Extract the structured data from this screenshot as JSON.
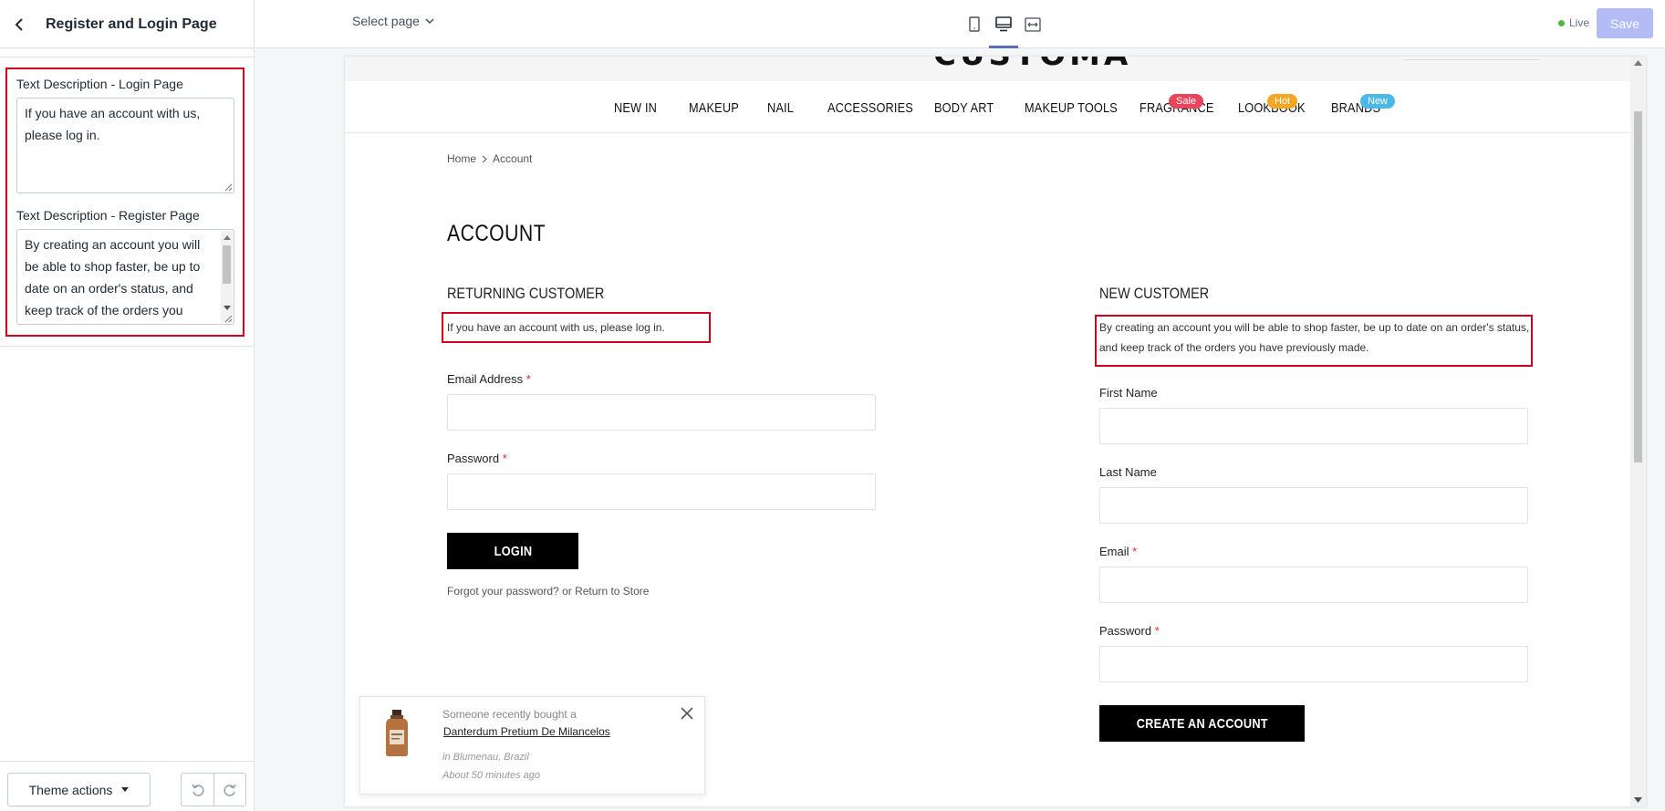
{
  "topbar": {
    "page_title": "Register and Login Page",
    "select_page": "Select page",
    "live_label": "Live",
    "save_label": "Save"
  },
  "sidebar": {
    "login_desc_label": "Text Description - Login Page",
    "login_desc_value": "If you have an account with us, please log in.",
    "register_desc_label": "Text Description - Register Page",
    "register_desc_value": "By creating an account you will be able to shop faster, be up to date on an order's status, and keep track of the orders you have previously made.",
    "theme_actions": "Theme actions"
  },
  "store": {
    "nav": [
      {
        "label": "NEW IN"
      },
      {
        "label": "MAKEUP"
      },
      {
        "label": "NAIL"
      },
      {
        "label": "ACCESSORIES"
      },
      {
        "label": "BODY ART"
      },
      {
        "label": "MAKEUP TOOLS"
      },
      {
        "label": "FRAGRANCE",
        "badge": "Sale",
        "badge_color": "#e8455d"
      },
      {
        "label": "LOOKBOOK",
        "badge": "Hot",
        "badge_color": "#f5a623"
      },
      {
        "label": "BRANDS",
        "badge": "New",
        "badge_color": "#4ab8e8"
      }
    ],
    "breadcrumb": {
      "home": "Home",
      "current": "Account"
    },
    "heading": "ACCOUNT",
    "returning": {
      "heading": "RETURNING CUSTOMER",
      "desc": "If you have an account with us, please log in.",
      "email_label": "Email Address",
      "password_label": "Password",
      "login_button": "LOGIN",
      "forgot_link": "Forgot your password?",
      "or_text": "or",
      "return_link": "Return to Store"
    },
    "new_customer": {
      "heading": "NEW CUSTOMER",
      "desc": "By creating an account you will be able to shop faster, be up to date on an order's status, and keep track of the orders you have previously made.",
      "first_name_label": "First Name",
      "last_name_label": "Last Name",
      "email_label": "Email",
      "password_label": "Password",
      "create_button": "CREATE AN ACCOUNT"
    },
    "required_mark": "*"
  },
  "popup": {
    "line1": "Someone recently bought a",
    "product": "Danterdum Pretium De Milancelos",
    "location": "in Blumenau, Brazil",
    "time": "About 50 minutes ago"
  },
  "colors": {
    "accent": "#5c6ac4",
    "highlight_outline": "#d0021b",
    "save_disabled": "#b3bcf5",
    "live_dot": "#50b83c"
  }
}
